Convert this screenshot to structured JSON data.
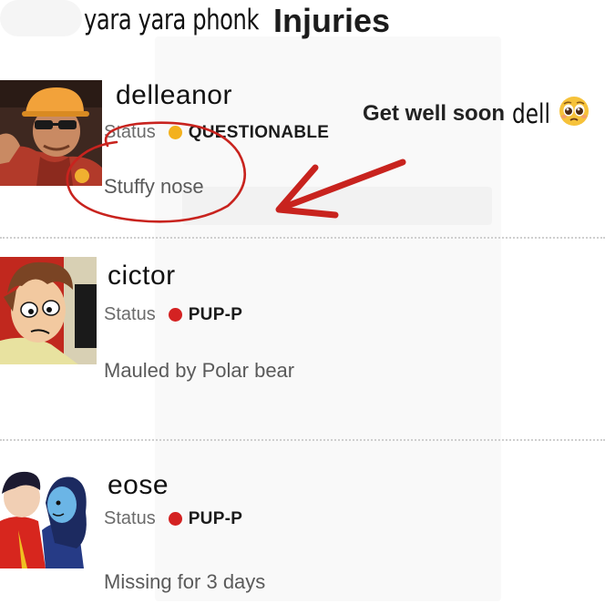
{
  "header": {
    "caption": "yara yara phonk",
    "title": "Injuries"
  },
  "annotation": {
    "message": "Get well soon",
    "handwritten": "dell",
    "emoji_icon": "pleading-face-icon"
  },
  "status_label": "Status",
  "players": [
    {
      "name": "delleanor",
      "status": "QUESTIONABLE",
      "status_color": "#f3b11d",
      "injury": "Stuffy nose",
      "avatar_icon": "engineer-avatar"
    },
    {
      "name": "cictor",
      "status": "PUP-P",
      "status_color": "#d42222",
      "injury": "Mauled by Polar bear",
      "avatar_icon": "cartoon-boy-avatar"
    },
    {
      "name": "eose",
      "status": "PUP-P",
      "status_color": "#d42222",
      "injury": "Missing for 3 days",
      "avatar_icon": "cartoon-couple-avatar"
    }
  ],
  "colors": {
    "annotation_red": "#c8231e"
  }
}
